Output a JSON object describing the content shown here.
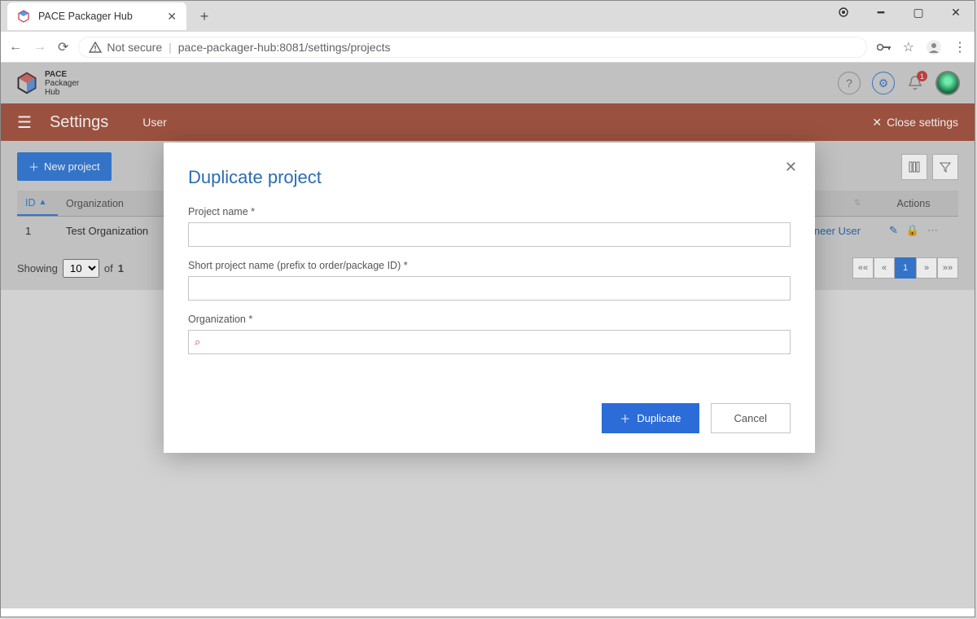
{
  "browser": {
    "tab_title": "PACE Packager Hub",
    "security_label": "Not secure",
    "url": "pace-packager-hub:8081/settings/projects"
  },
  "app_header": {
    "brand_line1": "PACE",
    "brand_line2": "Packager",
    "brand_line3": "Hub",
    "notification_count": "1"
  },
  "settings_bar": {
    "title": "Settings",
    "tab_users_prefix": "User",
    "close_label": "Close settings"
  },
  "toolbar": {
    "new_project_label": "New project"
  },
  "table": {
    "col_id": "ID",
    "col_org": "Organization",
    "col_actions": "Actions",
    "rows": [
      {
        "id": "1",
        "org": "Test Organization",
        "user": "Engineer User"
      }
    ]
  },
  "footer": {
    "showing": "Showing",
    "page_size": "10",
    "of": "of",
    "total": "1",
    "pager_first": "««",
    "pager_prev": "«",
    "pager_current": "1",
    "pager_next": "»",
    "pager_last": "»»"
  },
  "modal": {
    "title": "Duplicate project",
    "field_project_name": "Project name *",
    "field_short_name": "Short project name (prefix to order/package ID) *",
    "field_organization": "Organization *",
    "project_name_value": "",
    "short_name_value": "",
    "organization_value": "",
    "duplicate_label": "Duplicate",
    "cancel_label": "Cancel"
  }
}
